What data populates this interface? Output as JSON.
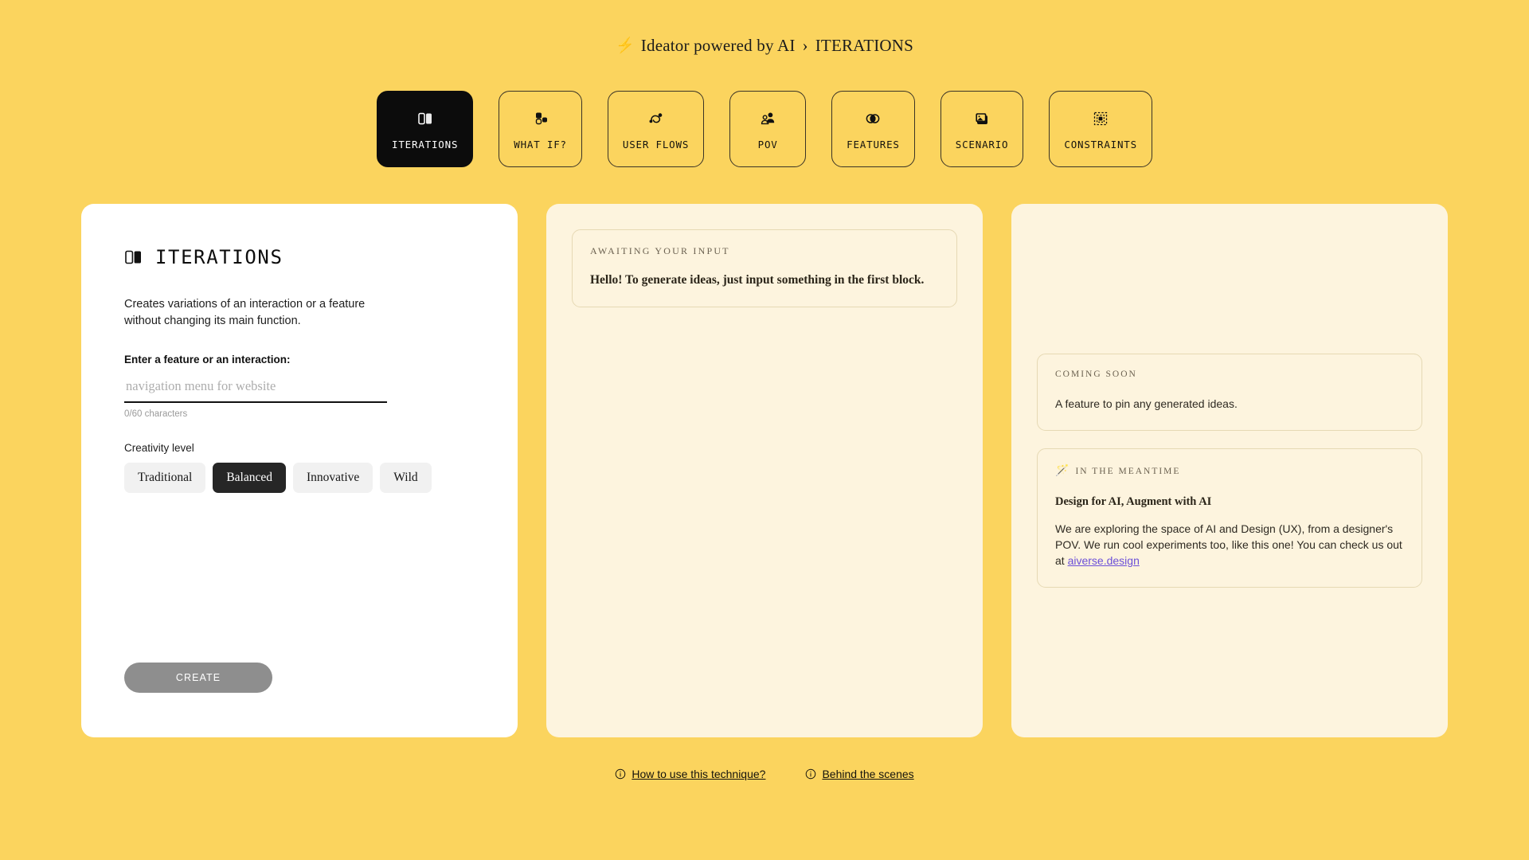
{
  "header": {
    "bolt_icon": "lightning-bolt-icon",
    "brand": "Ideator powered by AI",
    "separator": "›",
    "current": "ITERATIONS"
  },
  "tabs": [
    {
      "label": "ITERATIONS",
      "icon": "two-panels-icon",
      "active": true
    },
    {
      "label": "WHAT IF?",
      "icon": "scatter-blocks-icon",
      "active": false
    },
    {
      "label": "USER FLOWS",
      "icon": "flow-nodes-icon",
      "active": false
    },
    {
      "label": "POV",
      "icon": "persons-icon",
      "active": false
    },
    {
      "label": "FEATURES",
      "icon": "overlap-circles-icon",
      "active": false
    },
    {
      "label": "SCENARIO",
      "icon": "image-stack-icon",
      "active": false
    },
    {
      "label": "CONSTRAINTS",
      "icon": "crop-frame-icon",
      "active": false
    }
  ],
  "input_panel": {
    "icon": "two-panels-icon",
    "title": "ITERATIONS",
    "description": "Creates variations of an interaction or a feature without changing its main function.",
    "field_label": "Enter a feature or an interaction:",
    "input_value": "",
    "input_placeholder": "navigation menu for website",
    "char_count": "0/60 characters",
    "creativity_label": "Creativity level",
    "creativity_options": [
      {
        "label": "Traditional",
        "selected": false
      },
      {
        "label": "Balanced",
        "selected": true
      },
      {
        "label": "Innovative",
        "selected": false
      },
      {
        "label": "Wild",
        "selected": false
      }
    ],
    "create_label": "CREATE",
    "create_disabled": true
  },
  "output_panel": {
    "note": {
      "eyebrow": "AWAITING YOUR INPUT",
      "body": "Hello! To generate ideas, just input something in the first block."
    }
  },
  "info_panel": {
    "coming_soon": {
      "eyebrow": "COMING SOON",
      "body": "A feature to pin any generated ideas."
    },
    "meantime": {
      "wand_icon": "magic-wand-icon",
      "eyebrow": "IN THE MEANTIME",
      "heading": "Design for AI, Augment with AI",
      "body_before_link": "We are exploring the space of AI and Design (UX), from a designer's POV. We run cool experiments too, like this one! You can check us out at ",
      "link_text": "aiverse.design"
    }
  },
  "footer": {
    "links": [
      {
        "icon": "info-circle-icon",
        "label": "How to use this technique?"
      },
      {
        "icon": "info-circle-icon",
        "label": "Behind the scenes"
      }
    ]
  },
  "colors": {
    "page_background": "#FBD45E",
    "panel_cream": "#FDF4DE",
    "panel_white": "#FFFFFF",
    "active_tab": "#0C0C0C",
    "chip_selected": "#262626",
    "chip_idle": "#F1F1F1",
    "create_disabled": "#8E8E8E",
    "card_border": "#E6D9B4",
    "link_purple": "#6B4FD8",
    "muted_text": "#6B6150"
  }
}
